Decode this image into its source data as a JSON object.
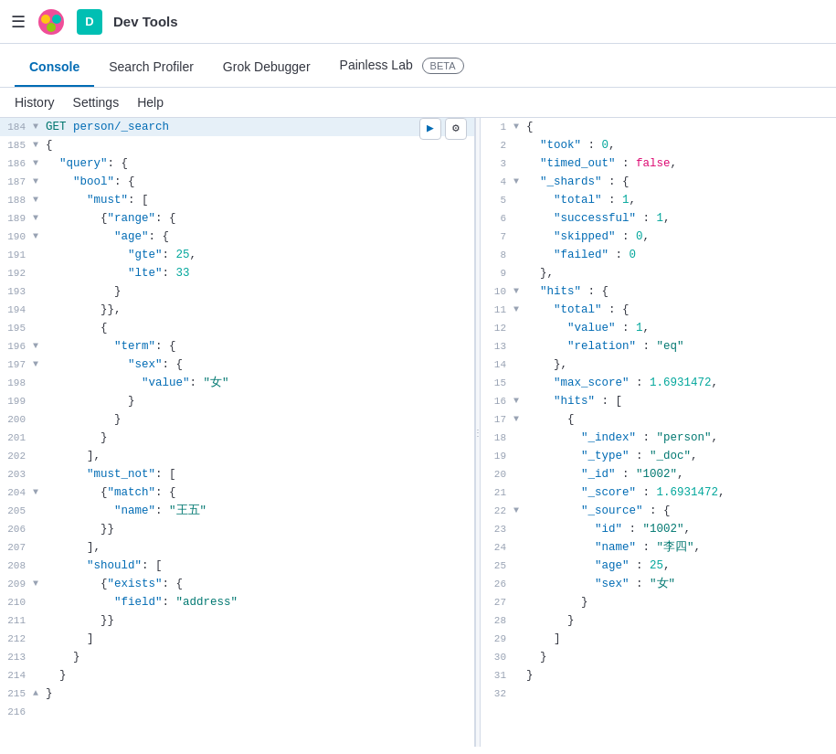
{
  "topbar": {
    "menu_icon": "☰",
    "user_initial": "D",
    "app_title": "Dev Tools"
  },
  "nav": {
    "tabs": [
      {
        "id": "console",
        "label": "Console",
        "active": true,
        "beta": false
      },
      {
        "id": "search-profiler",
        "label": "Search Profiler",
        "active": false,
        "beta": false
      },
      {
        "id": "grok-debugger",
        "label": "Grok Debugger",
        "active": false,
        "beta": false
      },
      {
        "id": "painless-lab",
        "label": "Painless Lab",
        "active": false,
        "beta": true
      }
    ],
    "beta_label": "BETA"
  },
  "subnav": {
    "items": [
      {
        "id": "history",
        "label": "History"
      },
      {
        "id": "settings",
        "label": "Settings"
      },
      {
        "id": "help",
        "label": "Help"
      }
    ]
  },
  "editor": {
    "lines": [
      {
        "num": "184",
        "fold": "▼",
        "highlighted": true,
        "content": "GET person/_search"
      },
      {
        "num": "185",
        "fold": "▼",
        "content": "{"
      },
      {
        "num": "186",
        "fold": "▼",
        "content": "  \"query\": {"
      },
      {
        "num": "187",
        "fold": "▼",
        "content": "    \"bool\": {"
      },
      {
        "num": "188",
        "fold": "▼",
        "content": "      \"must\": ["
      },
      {
        "num": "189",
        "fold": "▼",
        "content": "        {\"range\": {"
      },
      {
        "num": "190",
        "fold": "▼",
        "content": "          \"age\": {"
      },
      {
        "num": "191",
        "fold": " ",
        "content": "            \"gte\": 25,"
      },
      {
        "num": "192",
        "fold": " ",
        "content": "            \"lte\": 33"
      },
      {
        "num": "193",
        "fold": " ",
        "content": "          }"
      },
      {
        "num": "194",
        "fold": " ",
        "content": "        }},"
      },
      {
        "num": "195",
        "fold": " ",
        "content": "        {"
      },
      {
        "num": "196",
        "fold": "▼",
        "content": "          \"term\": {"
      },
      {
        "num": "197",
        "fold": "▼",
        "content": "            \"sex\": {"
      },
      {
        "num": "198",
        "fold": " ",
        "content": "              \"value\": \"女\""
      },
      {
        "num": "199",
        "fold": " ",
        "content": "            }"
      },
      {
        "num": "200",
        "fold": " ",
        "content": "          }"
      },
      {
        "num": "201",
        "fold": " ",
        "content": "        }"
      },
      {
        "num": "202",
        "fold": " ",
        "content": "      ],"
      },
      {
        "num": "203",
        "fold": " ",
        "content": "      \"must_not\": ["
      },
      {
        "num": "204",
        "fold": "▼",
        "content": "        {\"match\": {"
      },
      {
        "num": "205",
        "fold": " ",
        "content": "          \"name\": \"王五\""
      },
      {
        "num": "206",
        "fold": " ",
        "content": "        }}"
      },
      {
        "num": "207",
        "fold": " ",
        "content": "      ],"
      },
      {
        "num": "208",
        "fold": " ",
        "content": "      \"should\": ["
      },
      {
        "num": "209",
        "fold": "▼",
        "content": "        {\"exists\": {"
      },
      {
        "num": "210",
        "fold": " ",
        "content": "          \"field\": \"address\""
      },
      {
        "num": "211",
        "fold": " ",
        "content": "        }}"
      },
      {
        "num": "212",
        "fold": " ",
        "content": "      ]"
      },
      {
        "num": "213",
        "fold": " ",
        "content": "    }"
      },
      {
        "num": "214",
        "fold": " ",
        "content": "  }"
      },
      {
        "num": "215",
        "fold": "▲",
        "content": "}"
      },
      {
        "num": "216",
        "fold": " ",
        "content": ""
      }
    ]
  },
  "result": {
    "lines": [
      {
        "num": "1",
        "fold": "▼",
        "content": "{"
      },
      {
        "num": "2",
        "fold": " ",
        "content": "  \"took\" : 0,"
      },
      {
        "num": "3",
        "fold": " ",
        "content": "  \"timed_out\" : false,"
      },
      {
        "num": "4",
        "fold": "▼",
        "content": "  \"_shards\" : {"
      },
      {
        "num": "5",
        "fold": " ",
        "content": "    \"total\" : 1,"
      },
      {
        "num": "6",
        "fold": " ",
        "content": "    \"successful\" : 1,"
      },
      {
        "num": "7",
        "fold": " ",
        "content": "    \"skipped\" : 0,"
      },
      {
        "num": "8",
        "fold": " ",
        "content": "    \"failed\" : 0"
      },
      {
        "num": "9",
        "fold": " ",
        "content": "  },"
      },
      {
        "num": "10",
        "fold": "▼",
        "content": "  \"hits\" : {"
      },
      {
        "num": "11",
        "fold": "▼",
        "content": "    \"total\" : {"
      },
      {
        "num": "12",
        "fold": " ",
        "content": "      \"value\" : 1,"
      },
      {
        "num": "13",
        "fold": " ",
        "content": "      \"relation\" : \"eq\""
      },
      {
        "num": "14",
        "fold": " ",
        "content": "    },"
      },
      {
        "num": "15",
        "fold": " ",
        "content": "    \"max_score\" : 1.6931472,"
      },
      {
        "num": "16",
        "fold": "▼",
        "content": "    \"hits\" : ["
      },
      {
        "num": "17",
        "fold": "▼",
        "content": "      {"
      },
      {
        "num": "18",
        "fold": " ",
        "content": "        \"_index\" : \"person\","
      },
      {
        "num": "19",
        "fold": " ",
        "content": "        \"_type\" : \"_doc\","
      },
      {
        "num": "20",
        "fold": " ",
        "content": "        \"_id\" : \"1002\","
      },
      {
        "num": "21",
        "fold": " ",
        "content": "        \"_score\" : 1.6931472,"
      },
      {
        "num": "22",
        "fold": "▼",
        "content": "        \"_source\" : {"
      },
      {
        "num": "23",
        "fold": " ",
        "content": "          \"id\" : \"1002\","
      },
      {
        "num": "24",
        "fold": " ",
        "content": "          \"name\" : \"李四\","
      },
      {
        "num": "25",
        "fold": " ",
        "content": "          \"age\" : 25,"
      },
      {
        "num": "26",
        "fold": " ",
        "content": "          \"sex\" : \"女\""
      },
      {
        "num": "27",
        "fold": " ",
        "content": "        }"
      },
      {
        "num": "28",
        "fold": " ",
        "content": "      }"
      },
      {
        "num": "29",
        "fold": " ",
        "content": "    ]"
      },
      {
        "num": "30",
        "fold": " ",
        "content": "  }"
      },
      {
        "num": "31",
        "fold": " ",
        "content": "}"
      },
      {
        "num": "32",
        "fold": " ",
        "content": ""
      }
    ]
  },
  "icons": {
    "run": "▶",
    "wrench": "🔧",
    "resize": "⋮"
  }
}
